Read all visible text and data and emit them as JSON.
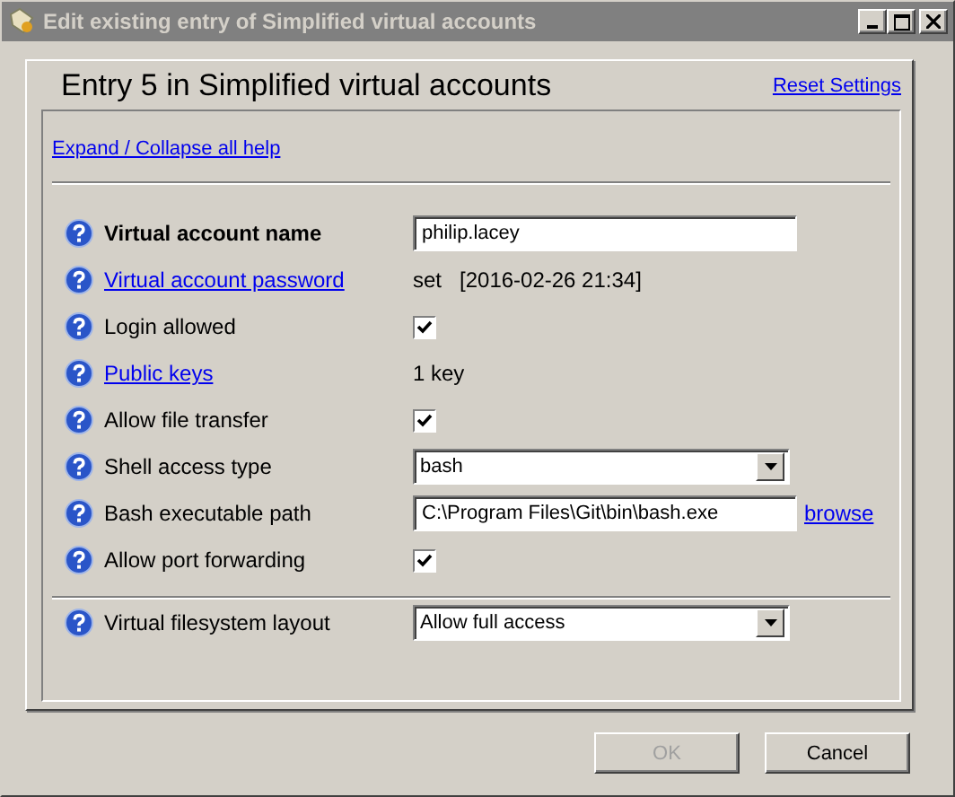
{
  "window": {
    "title": "Edit existing entry of Simplified virtual accounts"
  },
  "heading": "Entry 5 in Simplified virtual accounts",
  "reset_link": "Reset Settings",
  "help_link": "Expand / Collapse all help",
  "sections": [
    [
      {
        "label": "Virtual account name",
        "bold": true,
        "link": false,
        "kind": "input",
        "value": "philip.lacey"
      },
      {
        "label": "Virtual account password",
        "bold": false,
        "link": true,
        "kind": "text",
        "value": "set   [2016-02-26 21:34]"
      },
      {
        "label": "Login allowed",
        "bold": false,
        "link": false,
        "kind": "checkbox",
        "checked": true
      },
      {
        "label": "Public keys",
        "bold": false,
        "link": true,
        "kind": "text",
        "value": "1 key"
      },
      {
        "label": "Allow file transfer",
        "bold": false,
        "link": false,
        "kind": "checkbox",
        "checked": true
      },
      {
        "label": "Shell access type",
        "bold": false,
        "link": false,
        "kind": "select",
        "value": "bash"
      },
      {
        "label": "Bash executable path",
        "bold": false,
        "link": false,
        "kind": "path",
        "value": "C:\\Program Files\\Git\\bin\\bash.exe",
        "action": "browse"
      },
      {
        "label": "Allow port forwarding",
        "bold": false,
        "link": false,
        "kind": "checkbox",
        "checked": true
      }
    ],
    [
      {
        "label": "Virtual filesystem layout",
        "bold": false,
        "link": false,
        "kind": "select",
        "value": "Allow full access"
      }
    ]
  ],
  "buttons": [
    {
      "label": "OK",
      "disabled": true
    },
    {
      "label": "Cancel",
      "disabled": false
    }
  ]
}
